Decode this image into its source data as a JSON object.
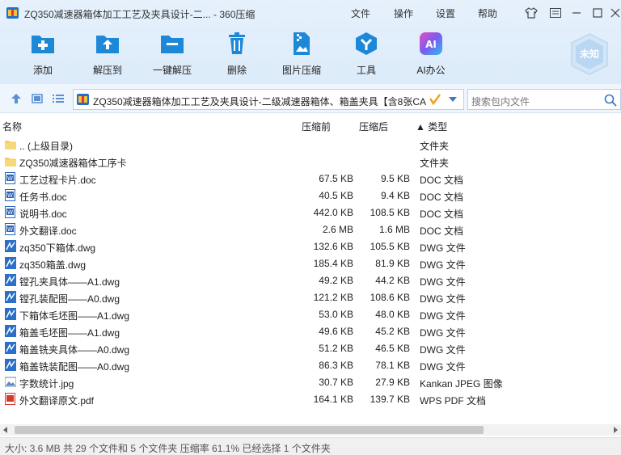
{
  "window": {
    "title": "ZQ350减速器箱体加工工艺及夹具设计-二... - 360压缩",
    "menus": [
      "文件",
      "操作",
      "设置",
      "帮助"
    ]
  },
  "toolbar": {
    "tools": [
      "添加",
      "解压到",
      "一键解压",
      "删除",
      "图片压缩",
      "工具",
      "AI办公"
    ],
    "badge": "未知"
  },
  "address": {
    "path": "ZQ350减速器箱体加工工艺及夹具设计-二级减速器箱体、箱盖夹具【含8张CA",
    "search_placeholder": "搜索包内文件"
  },
  "columns": {
    "name": "名称",
    "packed": "压缩前",
    "compressed": "压缩后",
    "type": "▲ 类型"
  },
  "files": [
    {
      "name": ".. (上级目录)",
      "before": "",
      "after": "",
      "type": "文件夹",
      "kind": "folder"
    },
    {
      "name": "ZQ350减速器箱体工序卡",
      "before": "",
      "after": "",
      "type": "文件夹",
      "kind": "folder"
    },
    {
      "name": "工艺过程卡片.doc",
      "before": "67.5 KB",
      "after": "9.5 KB",
      "type": "DOC 文档",
      "kind": "doc"
    },
    {
      "name": "任务书.doc",
      "before": "40.5 KB",
      "after": "9.4 KB",
      "type": "DOC 文档",
      "kind": "doc"
    },
    {
      "name": "说明书.doc",
      "before": "442.0 KB",
      "after": "108.5 KB",
      "type": "DOC 文档",
      "kind": "doc"
    },
    {
      "name": "外文翻译.doc",
      "before": "2.6 MB",
      "after": "1.6 MB",
      "type": "DOC 文档",
      "kind": "doc"
    },
    {
      "name": "zq350下箱体.dwg",
      "before": "132.6 KB",
      "after": "105.5 KB",
      "type": "DWG 文件",
      "kind": "dwg"
    },
    {
      "name": "zq350箱盖.dwg",
      "before": "185.4 KB",
      "after": "81.9 KB",
      "type": "DWG 文件",
      "kind": "dwg"
    },
    {
      "name": "镗孔夹具体——A1.dwg",
      "before": "49.2 KB",
      "after": "44.2 KB",
      "type": "DWG 文件",
      "kind": "dwg"
    },
    {
      "name": "镗孔装配图——A0.dwg",
      "before": "121.2 KB",
      "after": "108.6 KB",
      "type": "DWG 文件",
      "kind": "dwg"
    },
    {
      "name": "下箱体毛坯图——A1.dwg",
      "before": "53.0 KB",
      "after": "48.0 KB",
      "type": "DWG 文件",
      "kind": "dwg"
    },
    {
      "name": "箱盖毛坯图——A1.dwg",
      "before": "49.6 KB",
      "after": "45.2 KB",
      "type": "DWG 文件",
      "kind": "dwg"
    },
    {
      "name": "箱盖铣夹具体——A0.dwg",
      "before": "51.2 KB",
      "after": "46.5 KB",
      "type": "DWG 文件",
      "kind": "dwg"
    },
    {
      "name": "箱盖铣装配图——A0.dwg",
      "before": "86.3 KB",
      "after": "78.1 KB",
      "type": "DWG 文件",
      "kind": "dwg"
    },
    {
      "name": "字数统计.jpg",
      "before": "30.7 KB",
      "after": "27.9 KB",
      "type": "Kankan JPEG 图像",
      "kind": "jpg"
    },
    {
      "name": "外文翻译原文.pdf",
      "before": "164.1 KB",
      "after": "139.7 KB",
      "type": "WPS PDF 文档",
      "kind": "pdf"
    }
  ],
  "status": "大小: 3.6 MB 共 29 个文件和 5 个文件夹 压缩率 61.1% 已经选择 1 个文件夹",
  "colors": {
    "accent": "#1e88d8",
    "toolbar_bg": "#dcebfa"
  }
}
